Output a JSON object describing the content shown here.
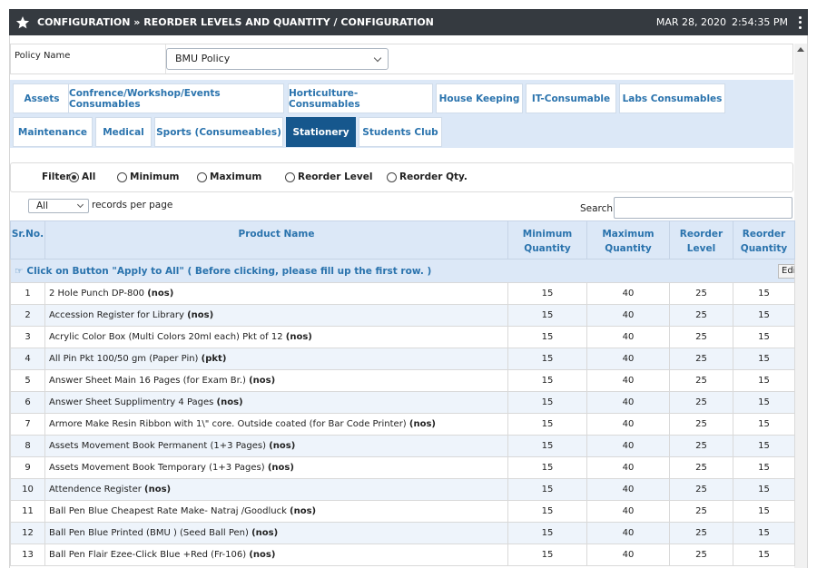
{
  "header": {
    "title": "CONFIGURATION » REORDER LEVELS AND QUANTITY / CONFIGURATION",
    "date": "MAR 28, 2020",
    "time": "2:54:35 PM"
  },
  "policy": {
    "label": "Policy Name",
    "selected": "BMU Policy"
  },
  "tabs": [
    {
      "label": "Assets"
    },
    {
      "label": "Confrence/Workshop/Events Consumables"
    },
    {
      "label": "Horticulture- Consumables"
    },
    {
      "label": "House Keeping"
    },
    {
      "label": "IT-Consumable"
    },
    {
      "label": "Labs Consumables"
    },
    {
      "label": "Maintenance"
    },
    {
      "label": "Medical"
    },
    {
      "label": "Sports (Consumeables)"
    },
    {
      "label": "Stationery"
    },
    {
      "label": "Students Club"
    }
  ],
  "active_tab": "Stationery",
  "filter": {
    "label": "Filter:",
    "options": [
      {
        "label": "All",
        "checked": true
      },
      {
        "label": "Minimum",
        "checked": false
      },
      {
        "label": "Maximum",
        "checked": false
      },
      {
        "label": "Reorder Level",
        "checked": false
      },
      {
        "label": "Reorder Qty.",
        "checked": false
      }
    ]
  },
  "paging": {
    "selected": "All",
    "suffix": "records per page",
    "search_label": "Search:",
    "search_value": ""
  },
  "table": {
    "headers": {
      "srno": "Sr.No.",
      "product": "Product Name",
      "min": "Minimum Quantity",
      "max": "Maximum Quantity",
      "reorder_level": "Reorder Level",
      "reorder_qty": "Reorder Quantity"
    },
    "apply_note": "Click on Button \"Apply to All\" ( Before clicking, please fill up the first row. )",
    "edit_label": "Edit",
    "rows": [
      {
        "sr": "1",
        "name": "2 Hole Punch DP-800",
        "unit": "(nos)",
        "min": "15",
        "max": "40",
        "level": "25",
        "qty": "15"
      },
      {
        "sr": "2",
        "name": "Accession Register for Library",
        "unit": "(nos)",
        "min": "15",
        "max": "40",
        "level": "25",
        "qty": "15"
      },
      {
        "sr": "3",
        "name": "Acrylic Color Box (Multi Colors 20ml each) Pkt of 12",
        "unit": "(nos)",
        "min": "15",
        "max": "40",
        "level": "25",
        "qty": "15"
      },
      {
        "sr": "4",
        "name": "All Pin Pkt 100/50 gm (Paper Pin)",
        "unit": "(pkt)",
        "min": "15",
        "max": "40",
        "level": "25",
        "qty": "15"
      },
      {
        "sr": "5",
        "name": "Answer Sheet Main 16 Pages (for Exam Br.)",
        "unit": "(nos)",
        "min": "15",
        "max": "40",
        "level": "25",
        "qty": "15"
      },
      {
        "sr": "6",
        "name": "Answer Sheet Supplimentry 4 Pages",
        "unit": "(nos)",
        "min": "15",
        "max": "40",
        "level": "25",
        "qty": "15"
      },
      {
        "sr": "7",
        "name": "Armore Make Resin Ribbon with 1\\\" core. Outside coated (for Bar Code Printer)",
        "unit": "(nos)",
        "min": "15",
        "max": "40",
        "level": "25",
        "qty": "15"
      },
      {
        "sr": "8",
        "name": "Assets Movement Book Permanent (1+3 Pages)",
        "unit": "(nos)",
        "min": "15",
        "max": "40",
        "level": "25",
        "qty": "15"
      },
      {
        "sr": "9",
        "name": "Assets Movement Book Temporary (1+3 Pages)",
        "unit": "(nos)",
        "min": "15",
        "max": "40",
        "level": "25",
        "qty": "15"
      },
      {
        "sr": "10",
        "name": "Attendence Register",
        "unit": "(nos)",
        "min": "15",
        "max": "40",
        "level": "25",
        "qty": "15"
      },
      {
        "sr": "11",
        "name": "Ball Pen Blue Cheapest Rate Make- Natraj /Goodluck",
        "unit": "(nos)",
        "min": "15",
        "max": "40",
        "level": "25",
        "qty": "15"
      },
      {
        "sr": "12",
        "name": "Ball Pen Blue Printed (BMU ) (Seed Ball Pen)",
        "unit": "(nos)",
        "min": "15",
        "max": "40",
        "level": "25",
        "qty": "15"
      },
      {
        "sr": "13",
        "name": "Ball Pen Flair Ezee-Click Blue +Red (Fr-106)",
        "unit": "(nos)",
        "min": "15",
        "max": "40",
        "level": "25",
        "qty": "15"
      }
    ]
  },
  "icons": {
    "star": "star-icon",
    "menu": "kebab-menu-icon",
    "hand": "pointing-hand-icon"
  },
  "colors": {
    "header_bg": "#353a40",
    "tab_active": "#16578d",
    "accent_text": "#2a73ad",
    "light_blue": "#dce8f7"
  }
}
